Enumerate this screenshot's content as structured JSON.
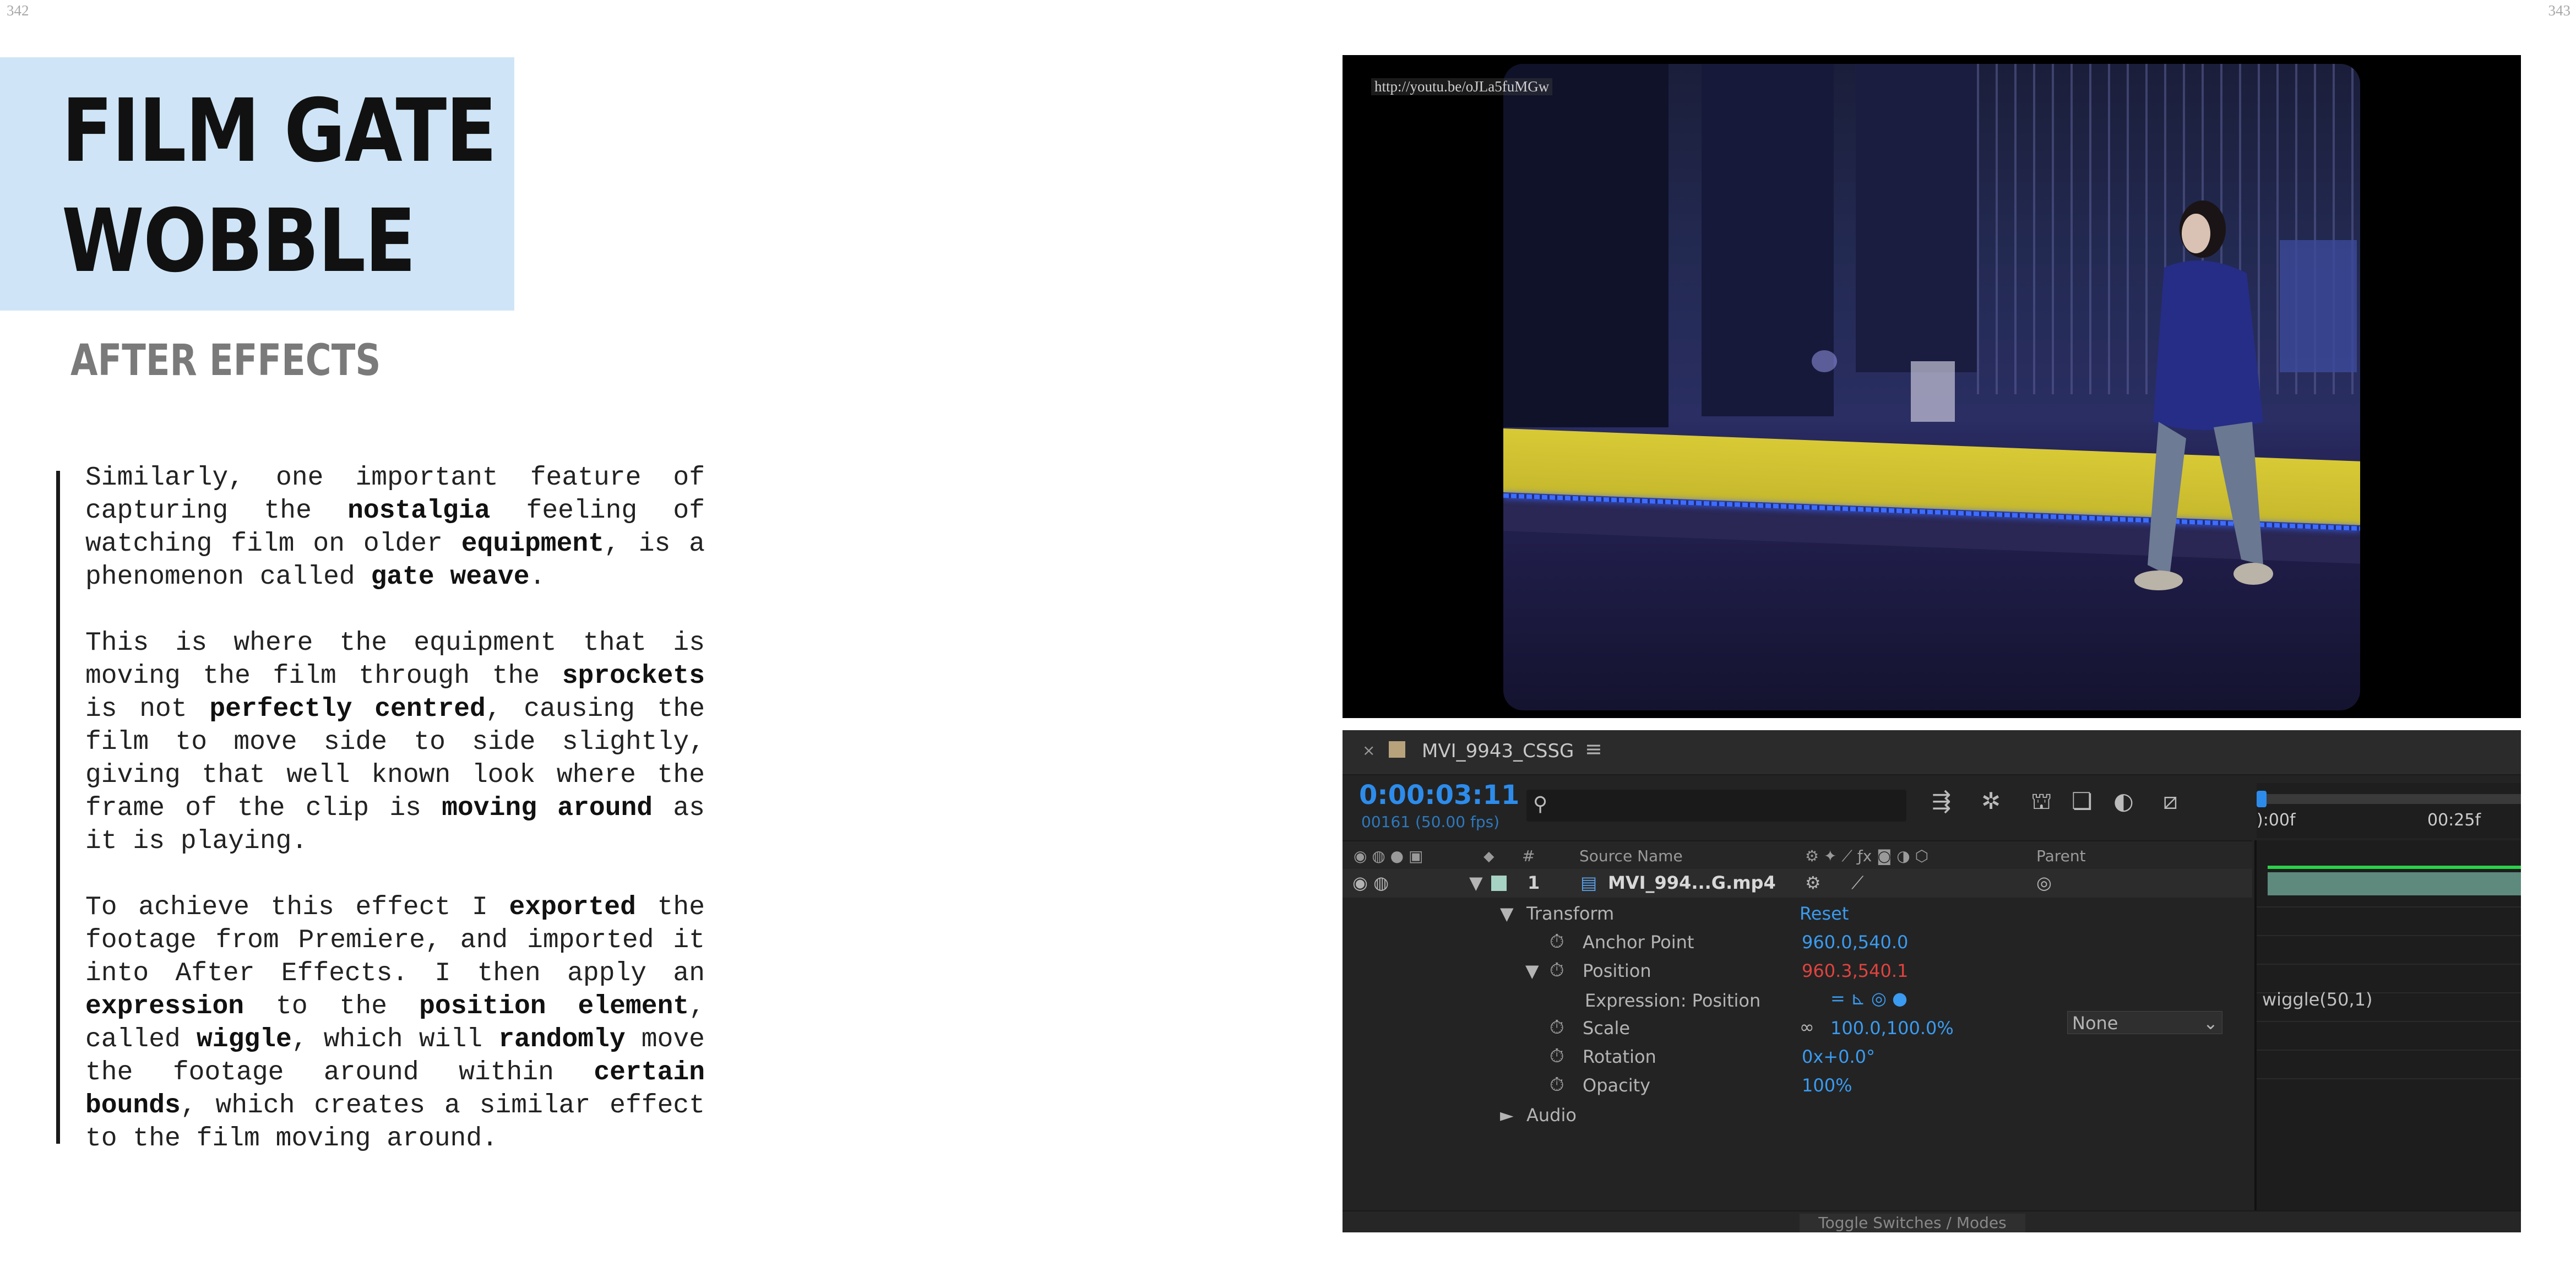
{
  "page_numbers": {
    "left": "342",
    "right": "343"
  },
  "title": "FILM GATE WOBBLE",
  "title_lines": [
    "FILM GATE",
    "WOBBLE"
  ],
  "subtitle": "AFTER EFFECTS",
  "colors": {
    "title_box": "#cfe5f7",
    "rule": "#1a1a1a",
    "timecode": "#2d8ceb",
    "red_value": "#e0433f"
  },
  "video": {
    "watermark_url": "http://youtu.be/oJLa5fuMGw"
  },
  "ae": {
    "close_label": "×",
    "comp_name": "MVI_9943_CSSG",
    "menu_icon": "≡",
    "timecode": "0:00:03:11",
    "frames": "00161 (50.00 fps)",
    "ruler_labels": [
      "):00f",
      "00:25f"
    ],
    "columns": {
      "number": "#",
      "source_name": "Source Name",
      "parent": "Parent"
    },
    "layer": {
      "number": "1",
      "name": "MVI_994...G.mp4",
      "parent": "None"
    },
    "transform_label": "Transform",
    "reset_label": "Reset",
    "props": [
      {
        "name": "Anchor Point",
        "value": "960.0,540.0"
      },
      {
        "name": "Position",
        "value": "960.3,540.1"
      },
      {
        "name": "Expression: Position",
        "value": ""
      },
      {
        "name": "Scale",
        "value": "100.0,100.0%"
      },
      {
        "name": "Rotation",
        "value": "0x+0.0°"
      },
      {
        "name": "Opacity",
        "value": "100%"
      }
    ],
    "audio_label": "Audio",
    "expression": "wiggle(50,1)",
    "footer_toggle": "Toggle Switches / Modes"
  }
}
